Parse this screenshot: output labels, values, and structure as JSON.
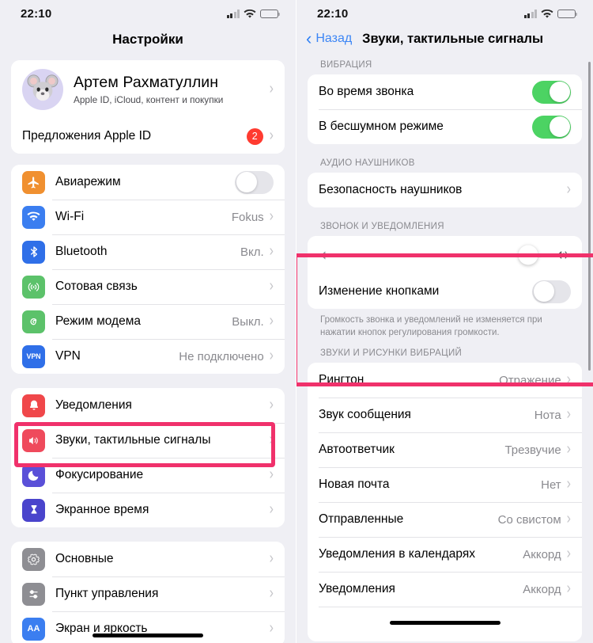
{
  "colors": {
    "highlight": "#f0316b",
    "accent_blue": "#3d86f5",
    "toggle_on": "#4cd363",
    "badge_red": "#ff3b30",
    "slider_fill": "#2f6fd8"
  },
  "left": {
    "status": {
      "time": "22:10",
      "signal_icon": "cellular-signal-icon",
      "wifi_icon": "wifi-icon",
      "battery_icon": "battery-icon"
    },
    "nav_title": "Настройки",
    "account": {
      "name": "Артем  Рахматуллин",
      "subtitle": "Apple ID, iCloud, контент и покупки",
      "avatar_icon": "mouse-memoji-avatar",
      "chevron": "›"
    },
    "apple_id_suggestions": {
      "label": "Предложения Apple ID",
      "badge": "2",
      "chevron": "›"
    },
    "group_connectivity": [
      {
        "label": "Авиарежим",
        "icon": "airplane-icon",
        "glyph": "✈",
        "icon_bg": "#f09030",
        "control": "toggle",
        "toggle_on": false
      },
      {
        "label": "Wi-Fi",
        "icon": "wifi-icon",
        "glyph": "≈",
        "icon_bg": "#3b7ef0",
        "value": "Fokus",
        "chevron": "›"
      },
      {
        "label": "Bluetooth",
        "icon": "bluetooth-icon",
        "glyph": "✦",
        "icon_bg": "#2f6fe8",
        "value": "Вкл.",
        "chevron": "›"
      },
      {
        "label": "Сотовая связь",
        "icon": "cellular-icon",
        "glyph": "((•))",
        "icon_bg": "#5cc26a",
        "value": "",
        "chevron": "›"
      },
      {
        "label": "Режим модема",
        "icon": "hotspot-icon",
        "glyph": "◎",
        "icon_bg": "#5cc26a",
        "value": "Выкл.",
        "chevron": "›"
      },
      {
        "label": "VPN",
        "icon": "vpn-icon",
        "glyph": "VPN",
        "icon_bg": "#2f6fe8",
        "value": "Не подключено",
        "chevron": "›"
      }
    ],
    "group_sounds": [
      {
        "label": "Уведомления",
        "icon": "bell-icon",
        "glyph": "🔔",
        "icon_bg": "#f0474a",
        "chevron": "›"
      },
      {
        "label": "Звуки, тактильные сигналы",
        "icon": "speaker-icon",
        "glyph": "🔊",
        "icon_bg": "#ef4a5c",
        "chevron": "›",
        "highlighted": true
      },
      {
        "label": "Фокусирование",
        "icon": "moon-icon",
        "glyph": "🌙",
        "icon_bg": "#5a50d8",
        "chevron": "›"
      },
      {
        "label": "Экранное время",
        "icon": "hourglass-icon",
        "glyph": "⌛",
        "icon_bg": "#4a44cc",
        "chevron": "›"
      }
    ],
    "group_general": [
      {
        "label": "Основные",
        "icon": "gear-icon",
        "glyph": "⚙",
        "icon_bg": "#8e8e93",
        "chevron": "›"
      },
      {
        "label": "Пункт управления",
        "icon": "control-center-icon",
        "glyph": "⚏",
        "icon_bg": "#8e8e93",
        "chevron": "›"
      },
      {
        "label": "Экран и яркость",
        "icon": "display-brightness-icon",
        "glyph": "AA",
        "icon_bg": "#3b7ef0",
        "chevron": "›"
      }
    ]
  },
  "right": {
    "status": {
      "time": "22:10",
      "signal_icon": "cellular-signal-icon",
      "wifi_icon": "wifi-icon",
      "battery_icon": "battery-icon"
    },
    "back_label": "Назад",
    "nav_heading": "Звуки, тактильные сигналы",
    "section_vibration": {
      "header": "ВИБРАЦИЯ",
      "rows": [
        {
          "label": "Во время звонка",
          "toggle_on": true
        },
        {
          "label": "В бесшумном режиме",
          "toggle_on": true
        }
      ]
    },
    "section_headphones": {
      "header": "АУДИО НАУШНИКОВ",
      "rows": [
        {
          "label": "Безопасность наушников",
          "chevron": "›"
        }
      ]
    },
    "section_ringer": {
      "header": "ЗВОНОК И УВЕДОМЛЕНИЯ",
      "slider": {
        "value_percent": 92,
        "low_icon": "speaker-low-icon",
        "high_icon": "speaker-high-icon"
      },
      "rows": [
        {
          "label": "Изменение кнопками",
          "toggle_on": false
        }
      ],
      "footer": "Громкость звонка и уведомлений не изменяется при нажатии кнопок регулирования громкости."
    },
    "section_tones": {
      "header": "ЗВУКИ И РИСУНКИ ВИБРАЦИЙ",
      "rows": [
        {
          "label": "Рингтон",
          "value": "Отражение",
          "chevron": "›"
        },
        {
          "label": "Звук сообщения",
          "value": "Нота",
          "chevron": "›"
        },
        {
          "label": "Автоответчик",
          "value": "Трезвучие",
          "chevron": "›"
        },
        {
          "label": "Новая почта",
          "value": "Нет",
          "chevron": "›"
        },
        {
          "label": "Отправленные",
          "value": "Со свистом",
          "chevron": "›"
        },
        {
          "label": "Уведомления в календарях",
          "value": "Аккорд",
          "chevron": "›"
        },
        {
          "label": "Уведомления",
          "value": "Аккорд",
          "chevron": "›"
        }
      ]
    }
  }
}
